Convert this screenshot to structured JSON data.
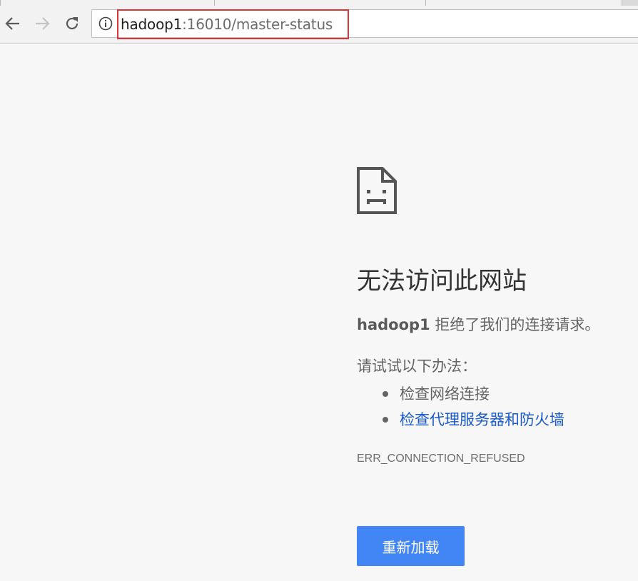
{
  "browser": {
    "url_host": "hadoop1",
    "url_rest": ":16010/master-status",
    "icons": {
      "back": "back-arrow-icon",
      "forward": "forward-arrow-icon",
      "reload": "reload-icon",
      "info": "info-icon"
    },
    "highlight_color": "#d9343a"
  },
  "error": {
    "icon": "sad-page-icon",
    "heading": "无法访问此网站",
    "host": "hadoop1",
    "description": " 拒绝了我们的连接请求。",
    "suggestions_title": "请试试以下办法：",
    "suggestions": [
      {
        "label": "检查网络连接",
        "link": false
      },
      {
        "label": "检查代理服务器和防火墙",
        "link": true
      }
    ],
    "code": "ERR_CONNECTION_REFUSED",
    "reload_label": "重新加载",
    "accent_color": "#4285f4",
    "link_color": "#1a5ac7"
  }
}
